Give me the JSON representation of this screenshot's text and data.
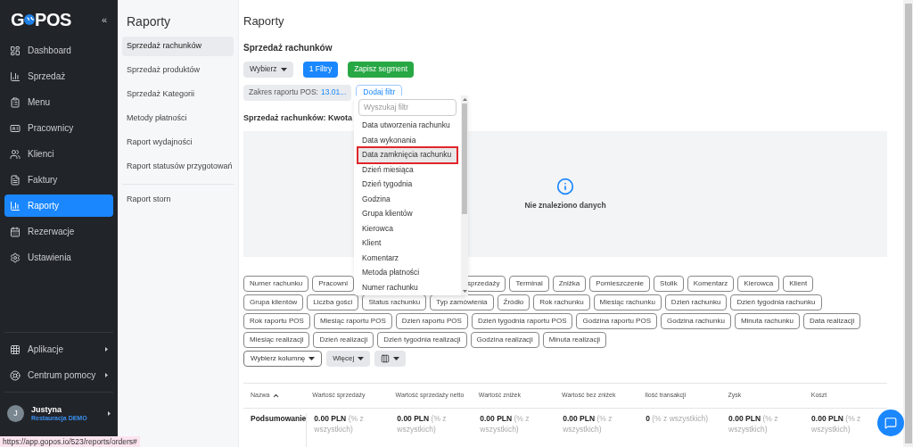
{
  "sidebar": {
    "logo": "G",
    "logo_rest": "POS",
    "collapse": "«",
    "items": [
      {
        "label": "Dashboard",
        "selected": false
      },
      {
        "label": "Sprzedaż",
        "selected": false
      },
      {
        "label": "Menu",
        "selected": false
      },
      {
        "label": "Pracownicy",
        "selected": false
      },
      {
        "label": "Klienci",
        "selected": false
      },
      {
        "label": "Faktury",
        "selected": false
      },
      {
        "label": "Raporty",
        "selected": true
      },
      {
        "label": "Rezerwacje",
        "selected": false
      },
      {
        "label": "Ustawienia",
        "selected": false
      }
    ],
    "bottom_items": [
      {
        "label": "Aplikacje"
      },
      {
        "label": "Centrum pomocy"
      }
    ],
    "user": {
      "initial": "J",
      "name": "Justyna",
      "venue": "Restauracja DEMO"
    }
  },
  "submenu": {
    "title": "Raporty",
    "items": [
      {
        "label": "Sprzedaż rachunków",
        "selected": true
      },
      {
        "label": "Sprzedaż produktów",
        "selected": false
      },
      {
        "label": "Sprzedaż Kategorii",
        "selected": false
      },
      {
        "label": "Metody płatności",
        "selected": false
      },
      {
        "label": "Raport wydajności",
        "selected": false
      },
      {
        "label": "Raport statusów przygotowań",
        "selected": false
      }
    ],
    "extra_items": [
      {
        "label": "Raport storn",
        "selected": false
      }
    ]
  },
  "main": {
    "title": "Raporty",
    "subtitle": "Sprzedaż rachunków",
    "buttons": [
      {
        "label": "Wybierz",
        "kind": "dropdown"
      },
      {
        "label": "1 Filtry",
        "kind": "primary"
      },
      {
        "label": "Zapisz segment",
        "kind": "success"
      }
    ],
    "range": {
      "label": "Zakres raportu POS:",
      "value": "13.01..."
    },
    "add_filter": "Dodaj filtr",
    "filter_menu": {
      "placeholder": "Wyszukaj filtr",
      "items": [
        {
          "label": "Data utworzenia rachunku",
          "highlighted": false
        },
        {
          "label": "Data wykonania",
          "highlighted": false
        },
        {
          "label": "Data zamknięcia rachunku",
          "highlighted": true
        },
        {
          "label": "Dzień miesiąca",
          "highlighted": false
        },
        {
          "label": "Dzień tygodnia",
          "highlighted": false
        },
        {
          "label": "Godzina",
          "highlighted": false
        },
        {
          "label": "Grupa klientów",
          "highlighted": false
        },
        {
          "label": "Kierowca",
          "highlighted": false
        },
        {
          "label": "Klient",
          "highlighted": false
        },
        {
          "label": "Komentarz",
          "highlighted": false
        },
        {
          "label": "Metoda płatności",
          "highlighted": false
        },
        {
          "label": "Numer rachunku",
          "highlighted": false
        }
      ]
    },
    "chart_title": "Sprzedaż rachunków: Kwota",
    "empty_text": "Nie znaleziono danych",
    "column_chips": [
      [
        "Numer rachunku",
        "Pracowni",
        "sprzedaży",
        "Terminal",
        "Zniżka",
        "Pomieszczenie",
        "Stolik",
        "Komentarz",
        "Kierowca",
        "Klient"
      ],
      [
        "Grupa klientów",
        "Liczba gości",
        "Status rachunku",
        "Typ zamówienia",
        "Źródło",
        "Rok rachunku",
        "Miesiąc rachunku",
        "Dzień rachunku",
        "Dzień tygodnia rachunku"
      ],
      [
        "Rok raportu POS",
        "Miesiąc raportu POS",
        "Dzień raportu POS",
        "Dzień tygodnia raportu POS",
        "Godzina raportu POS",
        "Godzina rachunku",
        "Minuta rachunku",
        "Data realizacji"
      ],
      [
        "Miesiąc realizacji",
        "Dzień realizacji",
        "Dzień tygodnia realizacji",
        "Godzina realizacji",
        "Minuta realizacji"
      ]
    ],
    "tools": [
      {
        "label": "Wybierz kolumnę",
        "kind": "outline"
      },
      {
        "label": "Więcej",
        "kind": "gray"
      },
      {
        "kind": "columns"
      }
    ],
    "table": {
      "columns": [
        "Nazwa",
        "Wartość sprzedaży",
        "Wartość sprzedaży netto",
        "Wartość zniżek",
        "Wartość bez zniżek",
        "Ilość transakcji",
        "Zysk",
        "Koszt"
      ],
      "rows": [
        {
          "cells": [
            {
              "value": "Podsumowanie"
            },
            {
              "value": "0.00 PLN",
              "note": "(% z wszystkich)"
            },
            {
              "value": "0.00 PLN",
              "note": "(% z wszystkich)"
            },
            {
              "value": "0.00 PLN",
              "note": "(% z wszystkich)"
            },
            {
              "value": "0.00 PLN",
              "note": "(% z wszystkich)"
            },
            {
              "value": "0",
              "note": "(% z wszystkich)"
            },
            {
              "value": "0.00 PLN",
              "note": "(% z wszystkich)"
            },
            {
              "value": "0.00 PLN",
              "note": "(% z wszystkich)"
            }
          ]
        }
      ]
    }
  },
  "status_url": "https://app.gopos.io/523/reports/orders#"
}
